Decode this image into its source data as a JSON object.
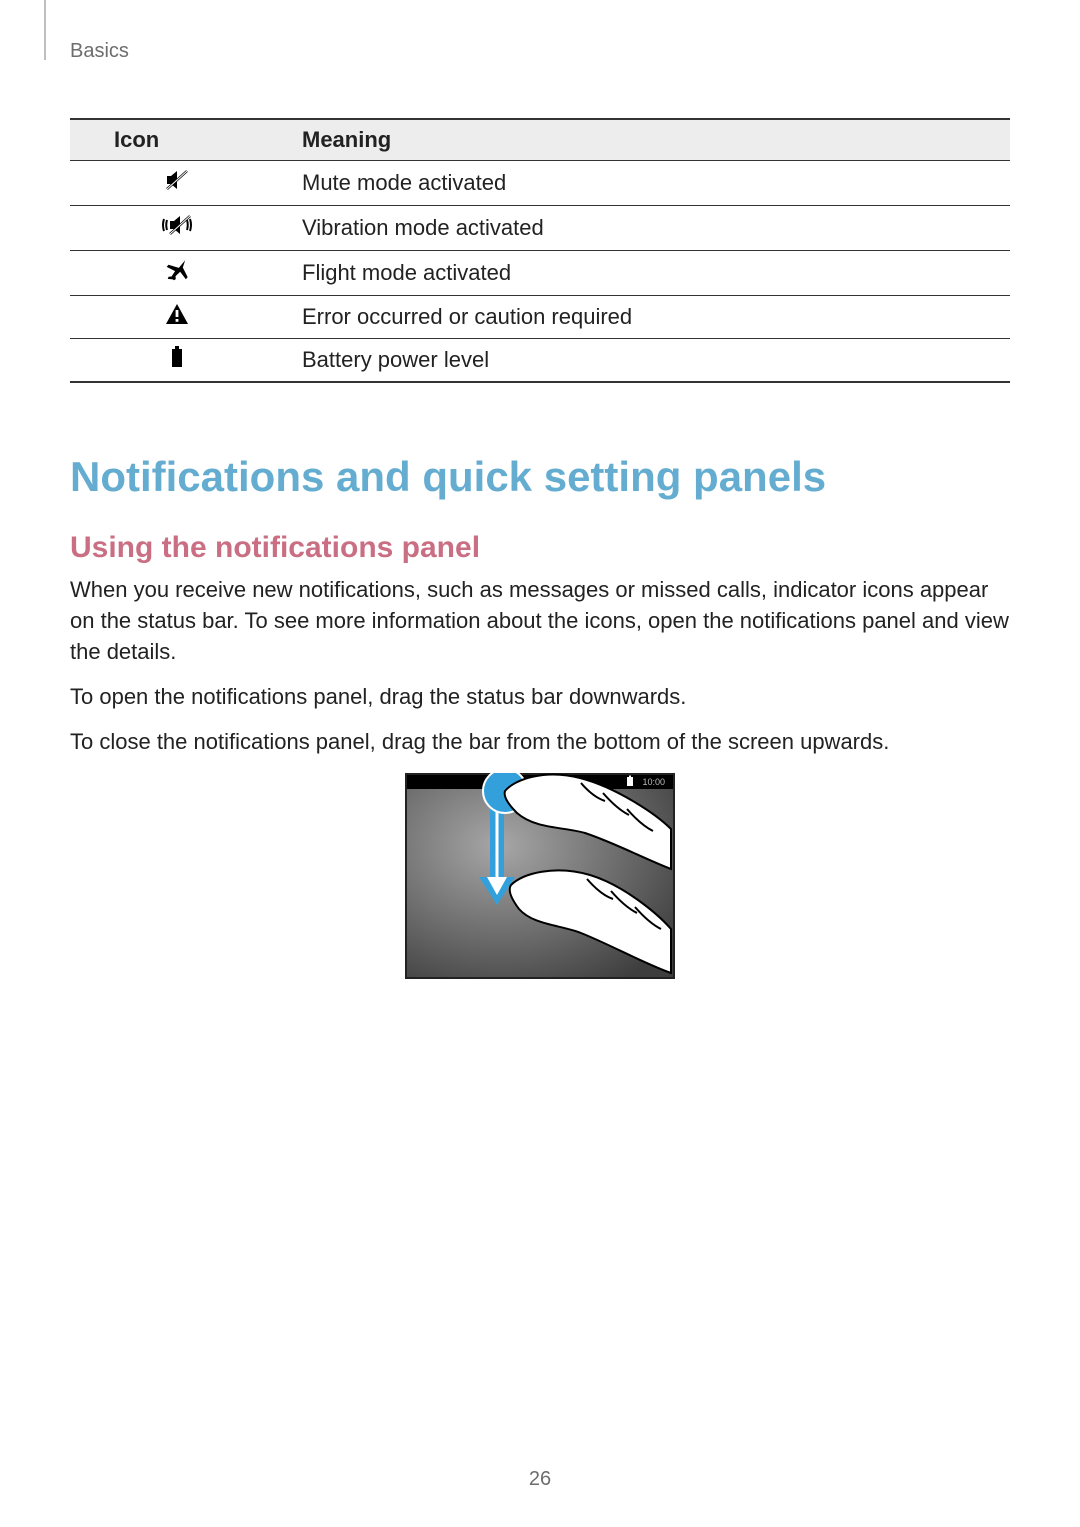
{
  "breadcrumb": "Basics",
  "table": {
    "headers": {
      "icon": "Icon",
      "meaning": "Meaning"
    },
    "rows": [
      {
        "icon_name": "mute-icon",
        "meaning": "Mute mode activated"
      },
      {
        "icon_name": "vibration-icon",
        "meaning": "Vibration mode activated"
      },
      {
        "icon_name": "flight-icon",
        "meaning": "Flight mode activated"
      },
      {
        "icon_name": "error-icon",
        "meaning": "Error occurred or caution required"
      },
      {
        "icon_name": "battery-icon",
        "meaning": "Battery power level"
      }
    ]
  },
  "heading": "Notifications and quick setting panels",
  "subheading": "Using the notifications panel",
  "paragraphs": [
    "When you receive new notifications, such as messages or missed calls, indicator icons appear on the status bar. To see more information about the icons, open the notifications panel and view the details.",
    "To open the notifications panel, drag the status bar downwards.",
    "To close the notifications panel, drag the bar from the bottom of the screen upwards."
  ],
  "illustration": {
    "status_time": "10:00",
    "alt": "Dragging the status bar downwards with a finger"
  },
  "page_number": "26"
}
